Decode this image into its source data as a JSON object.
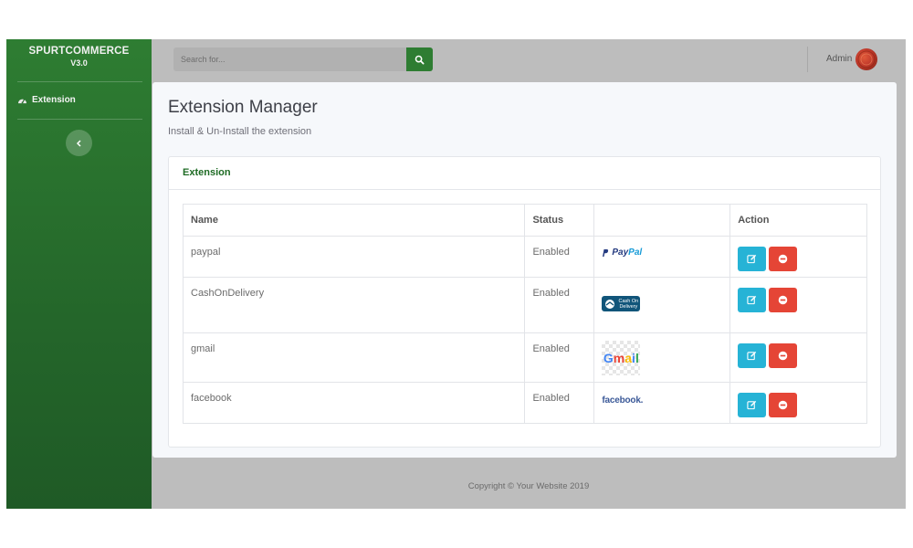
{
  "brand": {
    "name": "SPURTCOMMERCE",
    "version": "V3.0"
  },
  "sidebar": {
    "items": [
      {
        "label": "Extension",
        "icon": "dashboard-icon"
      }
    ],
    "collapse_icon": "chevron-left-icon"
  },
  "topbar": {
    "search_placeholder": "Search for...",
    "search_icon": "search-icon",
    "user_name": "Admin"
  },
  "page": {
    "title": "Extension Manager",
    "subtitle": "Install & Un-Install the extension"
  },
  "panel": {
    "title": "Extension"
  },
  "table": {
    "columns": [
      "Name",
      "Status",
      "",
      "Action"
    ],
    "rows": [
      {
        "name": "paypal",
        "status": "Enabled",
        "logo": "PayPal"
      },
      {
        "name": "CashOnDelivery",
        "status": "Enabled",
        "logo": "Cash On Delivery"
      },
      {
        "name": "gmail",
        "status": "Enabled",
        "logo": "Gmail"
      },
      {
        "name": "facebook",
        "status": "Enabled",
        "logo": "facebook."
      }
    ],
    "edit_icon": "edit-icon",
    "delete_icon": "minus-circle-icon"
  },
  "footer": {
    "copyright": "Copyright © Your Website 2019"
  },
  "colors": {
    "brand_green": "#2e7d32",
    "edit_button": "#26b3d6",
    "delete_button": "#e54536",
    "panel_title": "#1e6b24"
  }
}
